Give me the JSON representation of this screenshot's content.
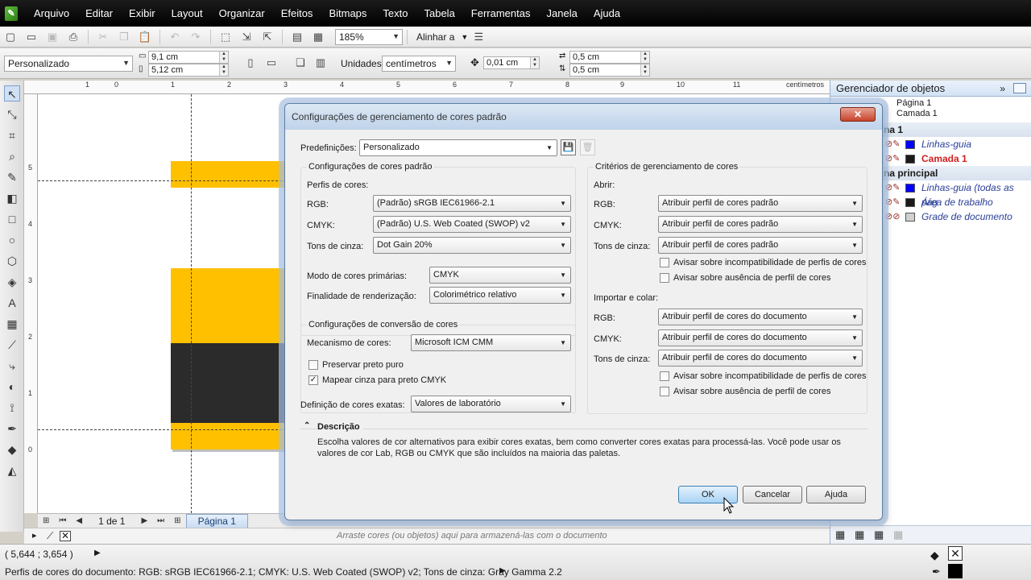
{
  "menu": [
    "Arquivo",
    "Editar",
    "Exibir",
    "Layout",
    "Organizar",
    "Efeitos",
    "Bitmaps",
    "Texto",
    "Tabela",
    "Ferramentas",
    "Janela",
    "Ajuda"
  ],
  "toolbar": {
    "zoom": "185%",
    "align_label": "Alinhar a"
  },
  "propbar": {
    "preset": "Personalizado",
    "width": "9,1 cm",
    "height": "5,12 cm",
    "units_label": "Unidades:",
    "units": "centímetros",
    "nudge": "0,01 cm",
    "dup_x": "0,5 cm",
    "dup_y": "0,5 cm"
  },
  "ruler": {
    "unit": "centímetros",
    "top_ticks": [
      "1",
      "0",
      "1",
      "2",
      "3",
      "4",
      "5",
      "6",
      "7",
      "8",
      "9",
      "10",
      "11"
    ],
    "left_ticks": [
      "5",
      "4",
      "3",
      "2",
      "1",
      "0"
    ]
  },
  "canvas_colors": {
    "yellow": "#ffc000",
    "dark": "#2b2b2b"
  },
  "pagenav": {
    "count": "1 de 1",
    "page_tab": "Página 1"
  },
  "palette_hint": "Arraste cores (ou objetos) aqui para armazená-las com o documento",
  "status": {
    "coords": "( 5,644 ; 3,654 )",
    "profiles": "Perfis de cores do documento: RGB: sRGB IEC61966-2.1; CMYK: U.S. Web Coated (SWOP) v2; Tons de cinza: Gray Gamma 2.2"
  },
  "docker": {
    "title": "Gerenciador de objetos",
    "page": "Página 1",
    "layer": "Camada 1",
    "page_band": "na 1",
    "master_band": "na principal",
    "rows": [
      {
        "name": "Linhas-guia",
        "color": "#0000ff"
      },
      {
        "name": "Camada 1",
        "color": "#1a1a1a"
      },
      {
        "name": "Linhas-guia (todas as pág",
        "color": "#0000ff"
      },
      {
        "name": "Área de trabalho",
        "color": "#1a1a1a"
      },
      {
        "name": "Grade de documento",
        "color": "#d0d0d0"
      }
    ]
  },
  "dialog": {
    "title": "Configurações de gerenciamento de cores padrão",
    "presets_label": "Predefinições:",
    "presets_value": "Personalizado",
    "left": {
      "group_title": "Configurações de cores padrão",
      "profiles_title": "Perfis de cores:",
      "rgb_label": "RGB:",
      "rgb_value": "(Padrão) sRGB IEC61966-2.1",
      "cmyk_label": "CMYK:",
      "cmyk_value": "(Padrão) U.S. Web Coated (SWOP) v2",
      "gray_label": "Tons de cinza:",
      "gray_value": "Dot Gain 20%",
      "primary_label": "Modo de cores primárias:",
      "primary_value": "CMYK",
      "intent_label": "Finalidade de renderização:",
      "intent_value": "Colorimétrico relativo",
      "conv_title": "Configurações de conversão de cores",
      "engine_label": "Mecanismo de cores:",
      "engine_value": "Microsoft ICM CMM",
      "preserve_black": "Preservar preto puro",
      "map_gray": "Mapear cinza para preto CMYK",
      "spot_label": "Definição de cores exatas:",
      "spot_value": "Valores de laboratório"
    },
    "right": {
      "group_title": "Critérios de gerenciamento de cores",
      "open_title": "Abrir:",
      "import_title": "Importar e colar:",
      "rgb_label": "RGB:",
      "cmyk_label": "CMYK:",
      "gray_label": "Tons de cinza:",
      "open_value": "Atribuir perfil de cores padrão",
      "import_value": "Atribuir perfil de cores do documento",
      "warn_mismatch": "Avisar sobre incompatibilidade de perfis de cores",
      "warn_missing": "Avisar sobre ausência de perfil de cores"
    },
    "description_title": "Descrição",
    "description": "Escolha valores de cor alternativos para exibir cores exatas, bem como converter cores exatas para processá-las. Você pode usar os valores de cor Lab, RGB ou CMYK que são incluídos na maioria das paletas.",
    "ok": "OK",
    "cancel": "Cancelar",
    "help": "Ajuda"
  }
}
